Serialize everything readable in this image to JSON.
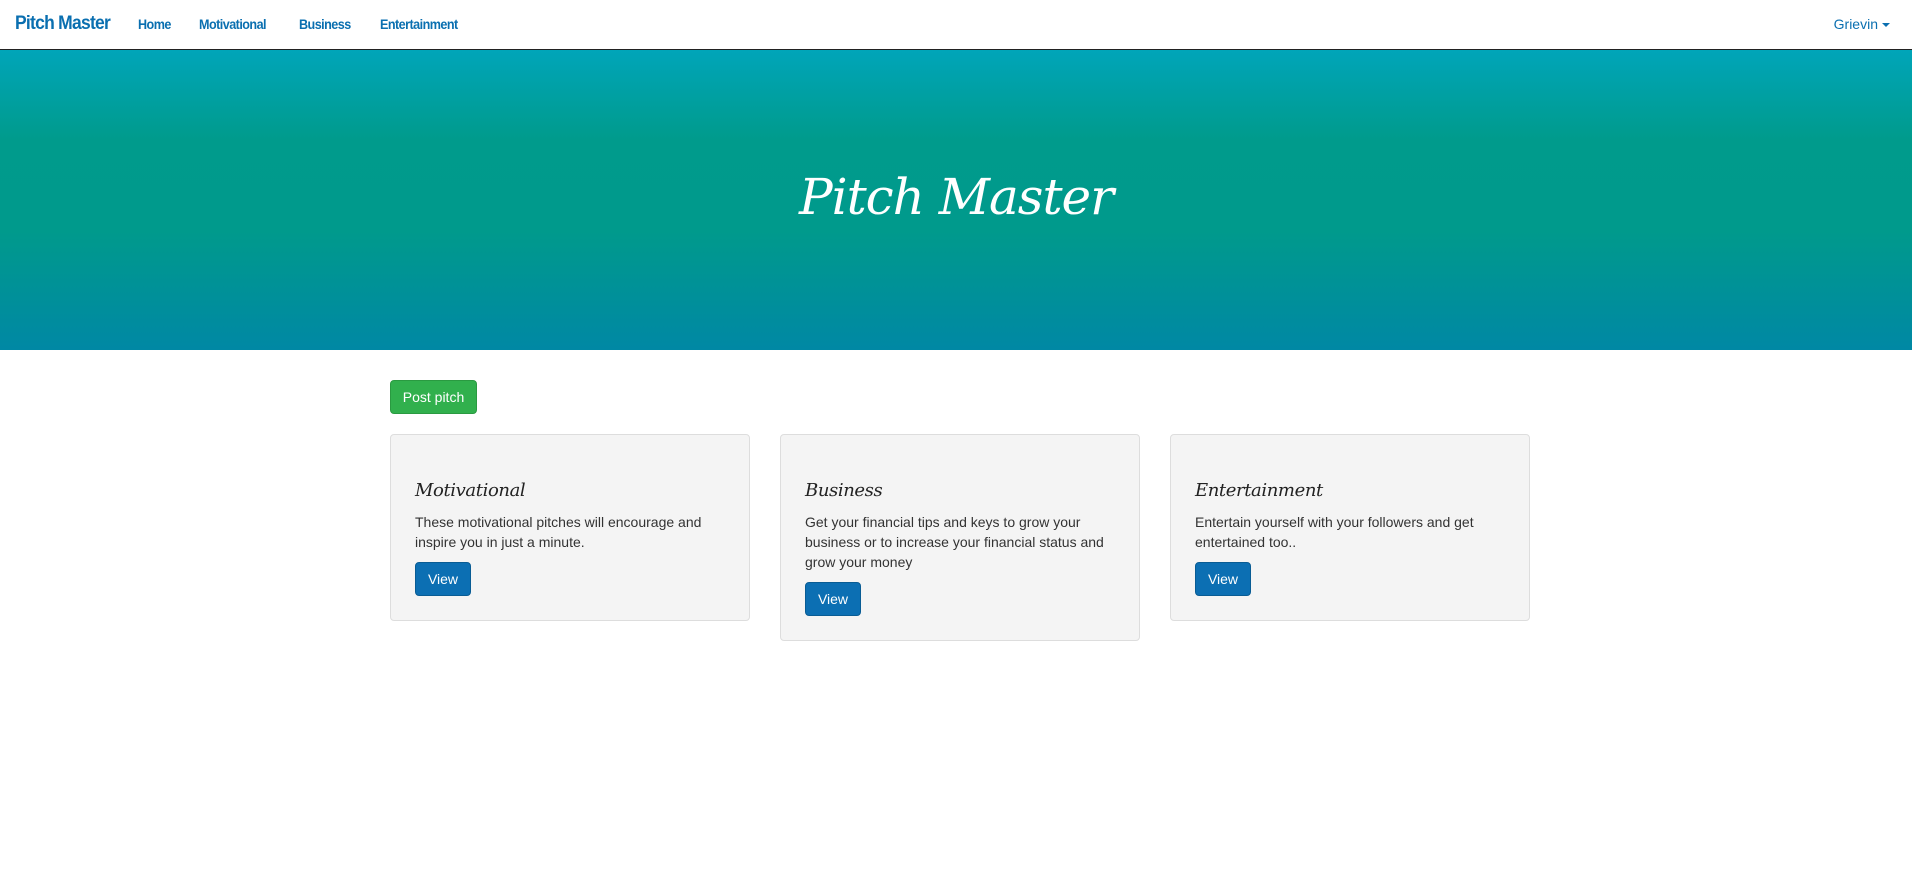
{
  "nav": {
    "brand": "Pitch Master",
    "links": [
      "Home",
      "Motivational",
      "Business",
      "Entertainment"
    ],
    "user": "Grievin"
  },
  "hero": {
    "title": "Pitch Master"
  },
  "actions": {
    "post_label": "Post pitch"
  },
  "cards": [
    {
      "title": "Motivational",
      "text": "These motivational pitches will encourage and inspire you in just a minute.",
      "button": "View"
    },
    {
      "title": "Business",
      "text": "Get your financial tips and keys to grow your business or to increase your financial status and grow your money",
      "button": "View"
    },
    {
      "title": "Entertainment",
      "text": "Entertain yourself with your followers and get entertained too..",
      "button": "View"
    }
  ],
  "colors": {
    "link": "#0a6fb0",
    "post_button": "#31b04d",
    "view_button": "#0c6fb3",
    "hero_top": "#00a5b9",
    "hero_bottom": "#0088a4"
  }
}
